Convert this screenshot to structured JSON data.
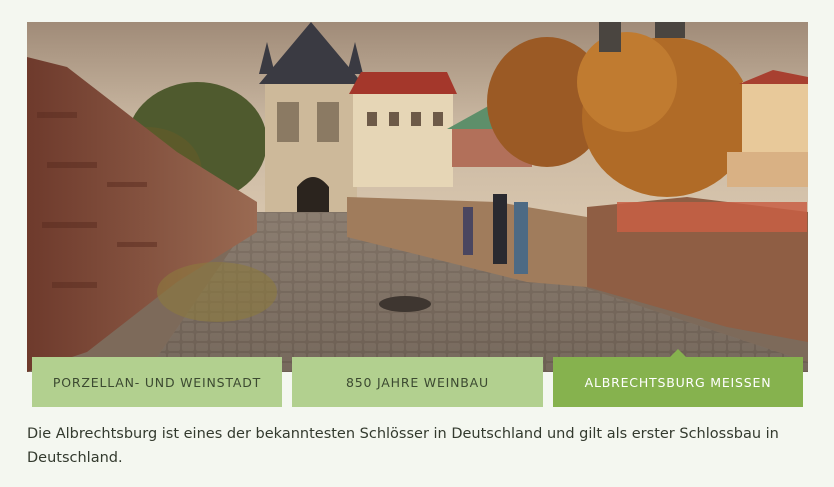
{
  "hero": {
    "image_name": "albrechtsburg-meissen-photo"
  },
  "tabs": [
    {
      "label": "PORZELLAN- UND WEINSTADT",
      "active": false
    },
    {
      "label": "850 JAHRE WEINBAU",
      "active": false
    },
    {
      "label": "ALBRECHTSBURG MEISSEN",
      "active": true
    }
  ],
  "description": "Die Albrechtsburg ist eines der bekanntesten Schlösser in Deutschland und gilt als erster Schlossbau in Deutschland.",
  "colors": {
    "page_background": "#f4f7f0",
    "tab_inactive": "#b2d08f",
    "tab_active": "#86b24e",
    "tab_text": "#3c4a31",
    "tab_active_text": "#ffffff",
    "body_text": "#333a2e"
  }
}
